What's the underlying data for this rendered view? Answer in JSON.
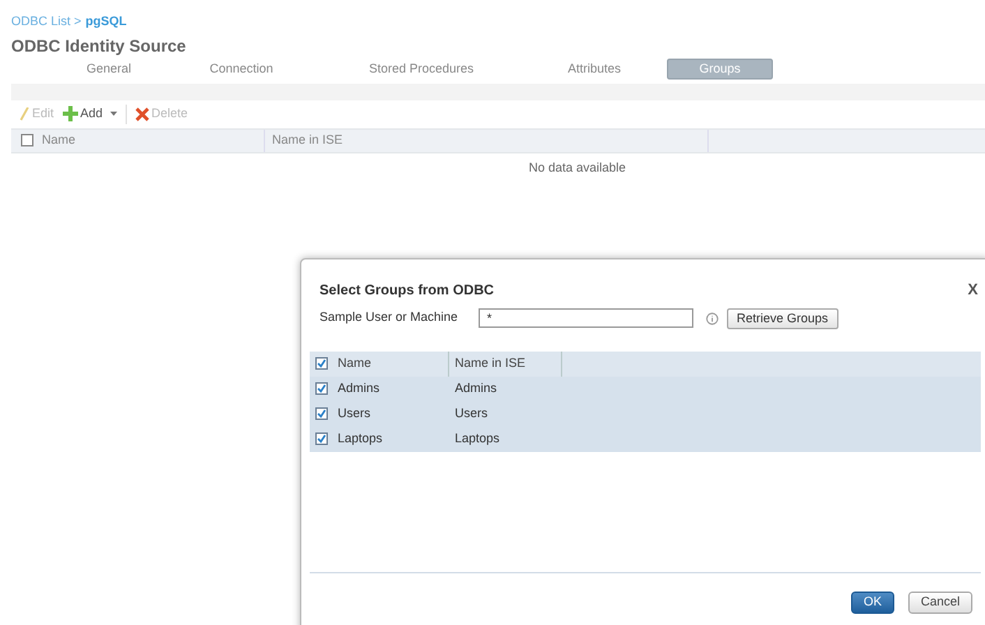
{
  "breadcrumb": {
    "parent": "ODBC List >",
    "current": "pgSQL"
  },
  "page_title": "ODBC Identity Source",
  "tabs": [
    {
      "label": "General",
      "selected": false
    },
    {
      "label": "Connection",
      "selected": false
    },
    {
      "label": "Stored Procedures",
      "selected": false
    },
    {
      "label": "Attributes",
      "selected": false
    },
    {
      "label": "Groups",
      "selected": true
    }
  ],
  "toolbar": [
    {
      "kind": "edit",
      "label": "Edit",
      "disabled": true
    },
    {
      "kind": "add",
      "label": "Add",
      "disabled": false
    },
    {
      "kind": "delete",
      "label": "Delete",
      "disabled": true
    }
  ],
  "table": {
    "columns": [
      "Name",
      "Name in ISE"
    ],
    "select_all_checked": false,
    "empty_text": "No data available"
  },
  "dialog": {
    "title": "Select Groups from ODBC",
    "close": "X",
    "field_label": "Sample User or Machine",
    "field_value": "*",
    "retrieve_button": "Retrieve Groups",
    "columns": [
      "Name",
      "Name in ISE"
    ],
    "select_all_checked": true,
    "rows": [
      {
        "name": "Admins",
        "name_in_ise": "Admins",
        "checked": true
      },
      {
        "name": "Users",
        "name_in_ise": "Users",
        "checked": true
      },
      {
        "name": "Laptops",
        "name_in_ise": "Laptops",
        "checked": true
      }
    ],
    "buttons": [
      {
        "kind": "primary",
        "label": "OK"
      },
      {
        "kind": "secondary",
        "label": "Cancel"
      }
    ]
  }
}
